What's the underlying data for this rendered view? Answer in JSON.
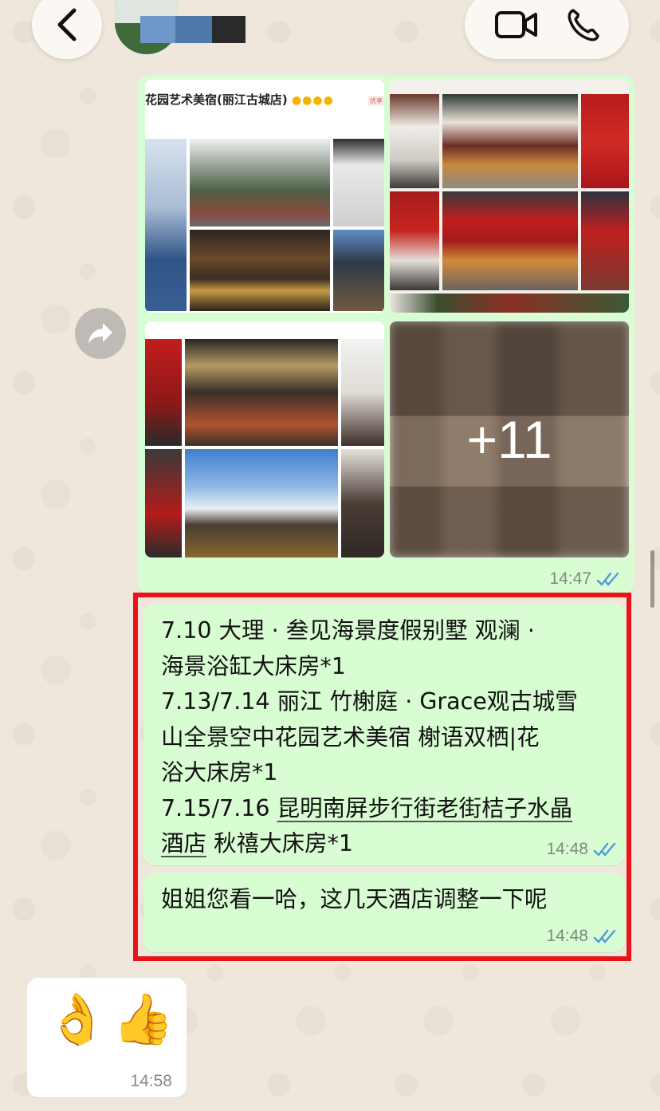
{
  "header": {
    "contact_subtitle": "",
    "back_icon": "chevron-left-icon",
    "video_icon": "video-camera-icon",
    "phone_icon": "phone-icon"
  },
  "image_message": {
    "hotel_card_title": "花园艺术美宿(丽江古城店)",
    "hotel_card_stars": "●●●●",
    "hotel_card_badge": "优享",
    "more_count": "+11",
    "time": "14:47",
    "status": "read"
  },
  "text_messages": [
    {
      "lines": [
        "7.10  大理 · 叁见海景度假别墅  观澜 ·",
        "海景浴缸大床房*1",
        "7.13/7.14  丽江 竹榭庭 · Grace观古城雪",
        "山全景空中花园艺术美宿  榭语双栖|花",
        "浴大床房*1"
      ],
      "line6_prefix": "7.15/7.16 ",
      "line6_link": "昆明南屏步行街老街桔子水晶",
      "line7_link": "酒店",
      "line7_suffix": "  秋禧大床房*1",
      "time": "14:48",
      "status": "read"
    },
    {
      "text": "姐姐您看一哈，这几天酒店调整一下呢",
      "time": "14:48",
      "status": "read"
    }
  ],
  "incoming_message": {
    "emoji": "👌👍",
    "time": "14:58"
  },
  "colors": {
    "outgoing_bubble": "#d9fdd3",
    "incoming_bubble": "#ffffff",
    "highlight_frame": "#e8141a",
    "read_ticks": "#4f9bd9",
    "wallpaper": "#efe7dc"
  }
}
